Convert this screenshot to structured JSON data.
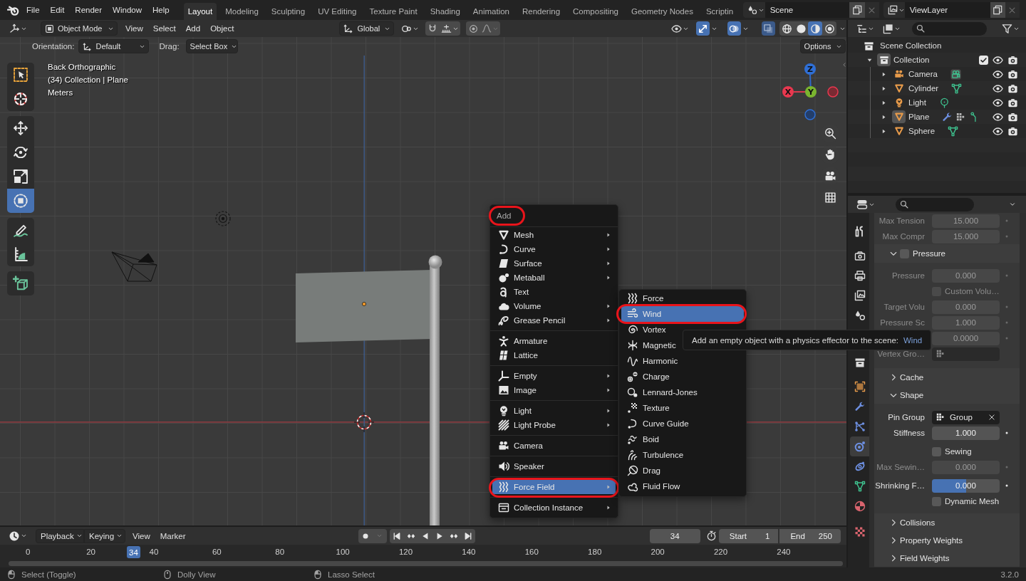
{
  "top_bar": {
    "menus": [
      "File",
      "Edit",
      "Render",
      "Window",
      "Help"
    ],
    "workspaces": [
      {
        "label": "Layout",
        "selected": true
      },
      {
        "label": "Modeling",
        "selected": false
      },
      {
        "label": "Sculpting",
        "selected": false
      },
      {
        "label": "UV Editing",
        "selected": false
      },
      {
        "label": "Texture Paint",
        "selected": false
      },
      {
        "label": "Shading",
        "selected": false
      },
      {
        "label": "Animation",
        "selected": false
      },
      {
        "label": "Rendering",
        "selected": false
      },
      {
        "label": "Compositing",
        "selected": false
      },
      {
        "label": "Geometry Nodes",
        "selected": false
      },
      {
        "label": "Scriptin",
        "selected": false
      }
    ],
    "scene": "Scene",
    "view_layer": "ViewLayer"
  },
  "viewport": {
    "header": {
      "mode": "Object Mode",
      "menus": [
        "View",
        "Select",
        "Add",
        "Object"
      ],
      "orientation": "Global",
      "gizmos_on": true,
      "overlays_on": true,
      "xray_on": true,
      "shading": [
        {
          "selected": false
        },
        {
          "selected": false
        },
        {
          "selected": true
        },
        {
          "selected": false
        }
      ]
    },
    "tool_settings": {
      "orientation_label": "Orientation:",
      "orientation": "Default",
      "drag_label": "Drag:",
      "drag": "Select Box",
      "options": "Options"
    },
    "tool_groups": [
      [
        {
          "selected": false
        },
        {
          "selected": false
        }
      ],
      [
        {
          "selected": false
        },
        {
          "selected": false
        },
        {
          "selected": false
        },
        {
          "selected": true
        }
      ],
      [
        {
          "selected": false
        },
        {
          "selected": false
        }
      ],
      [
        {
          "selected": false
        }
      ]
    ],
    "overlay_text": [
      "Back Orthographic",
      "(34) Collection | Plane",
      "Meters"
    ],
    "gizmo_labels": [
      "Z",
      "X",
      "Y"
    ]
  },
  "add_menu": {
    "title": "Add",
    "circled": true,
    "groups": [
      [
        {
          "label": "Mesh",
          "submenu": true,
          "selected": false,
          "circled": false
        },
        {
          "label": "Curve",
          "submenu": true,
          "selected": false,
          "circled": false
        },
        {
          "label": "Surface",
          "submenu": true,
          "selected": false,
          "circled": false
        },
        {
          "label": "Metaball",
          "submenu": true,
          "selected": false,
          "circled": false
        },
        {
          "label": "Text",
          "submenu": false,
          "selected": false,
          "circled": false
        },
        {
          "label": "Volume",
          "submenu": true,
          "selected": false,
          "circled": false
        },
        {
          "label": "Grease Pencil",
          "submenu": true,
          "selected": false,
          "circled": false
        }
      ],
      [
        {
          "label": "Armature",
          "submenu": false,
          "selected": false,
          "circled": false
        },
        {
          "label": "Lattice",
          "submenu": false,
          "selected": false,
          "circled": false
        }
      ],
      [
        {
          "label": "Empty",
          "submenu": true,
          "selected": false,
          "circled": false
        },
        {
          "label": "Image",
          "submenu": true,
          "selected": false,
          "circled": false
        }
      ],
      [
        {
          "label": "Light",
          "submenu": true,
          "selected": false,
          "circled": false
        },
        {
          "label": "Light Probe",
          "submenu": true,
          "selected": false,
          "circled": false
        }
      ],
      [
        {
          "label": "Camera",
          "submenu": false,
          "selected": false,
          "circled": false
        }
      ],
      [
        {
          "label": "Speaker",
          "submenu": false,
          "selected": false,
          "circled": false
        }
      ],
      [
        {
          "label": "Force Field",
          "submenu": true,
          "selected": true,
          "circled": true
        }
      ],
      [
        {
          "label": "Collection Instance",
          "submenu": true,
          "selected": false,
          "circled": false
        }
      ]
    ]
  },
  "force_field_menu": {
    "items": [
      {
        "label": "Force",
        "selected": false,
        "circled": false
      },
      {
        "label": "Wind",
        "selected": true,
        "circled": true
      },
      {
        "label": "Vortex",
        "selected": false,
        "circled": false
      },
      {
        "label": "Magnetic",
        "selected": false,
        "circled": false
      },
      {
        "label": "Harmonic",
        "selected": false,
        "circled": false
      },
      {
        "label": "Charge",
        "selected": false,
        "circled": false
      },
      {
        "label": "Lennard-Jones",
        "selected": false,
        "circled": false
      },
      {
        "label": "Texture",
        "selected": false,
        "circled": false
      },
      {
        "label": "Curve Guide",
        "selected": false,
        "circled": false
      },
      {
        "label": "Boid",
        "selected": false,
        "circled": false
      },
      {
        "label": "Turbulence",
        "selected": false,
        "circled": false
      },
      {
        "label": "Drag",
        "selected": false,
        "circled": false
      },
      {
        "label": "Fluid Flow",
        "selected": false,
        "circled": false
      }
    ]
  },
  "tooltip": {
    "text": "Add an empty object with a physics effector to the scene:",
    "operator": "Wind"
  },
  "outliner": {
    "root": "Scene Collection",
    "collection": {
      "label": "Collection",
      "expanded": true,
      "active": true,
      "checked": true,
      "children": [
        {
          "label": "Camera",
          "expanded": false,
          "active": false
        },
        {
          "label": "Cylinder",
          "expanded": false,
          "active": false
        },
        {
          "label": "Light",
          "expanded": false,
          "active": false
        },
        {
          "label": "Plane",
          "expanded": false,
          "active": true
        },
        {
          "label": "Sphere",
          "expanded": false,
          "active": false
        }
      ]
    }
  },
  "properties": {
    "tab_groups": [
      [
        {
          "selected": false
        }
      ],
      [
        {
          "selected": false
        },
        {
          "selected": false
        },
        {
          "selected": false
        },
        {
          "selected": false
        }
      ],
      [
        {
          "selected": false
        }
      ],
      [
        {
          "selected": false
        },
        {
          "selected": false
        },
        {
          "selected": false
        },
        {
          "selected": true
        },
        {
          "selected": false
        },
        {
          "selected": false
        },
        {
          "selected": false
        }
      ],
      [
        {
          "selected": false
        }
      ]
    ],
    "rows": [
      {
        "kind": "number",
        "label": "Max Tension",
        "value": "15.000",
        "disabled": true
      },
      {
        "kind": "number",
        "label": "Max Compr",
        "value": "15.000",
        "disabled": true
      }
    ],
    "subpanels": [
      {
        "title": "Pressure",
        "expanded": true,
        "checked": false,
        "blocks": [
          [
            {
              "kind": "number",
              "label": "Pressure",
              "value": "0.000",
              "disabled": true
            },
            {
              "kind": "checkbox",
              "label": "Custom Volu…",
              "checked": false,
              "disabled": true
            },
            {
              "kind": "number",
              "label": "Target Volu",
              "value": "0.000",
              "disabled": true
            },
            {
              "kind": "number",
              "label": "Pressure Sc",
              "value": "1.000",
              "disabled": true
            },
            {
              "kind": "number",
              "value": "0.0000",
              "disabled": true
            },
            {
              "kind": "group",
              "label": "Vertex Gro…",
              "disabled": true
            }
          ]
        ]
      },
      {
        "title": "Cache",
        "expanded": false
      },
      {
        "title": "Shape",
        "expanded": true,
        "blocks": [
          [
            {
              "kind": "group",
              "label": "Pin Group",
              "value": "Group",
              "disabled": false
            },
            {
              "kind": "number",
              "label": "Stiffness",
              "value": "1.000",
              "disabled": false
            }
          ],
          [
            {
              "kind": "checkbox",
              "label": "Sewing",
              "checked": false,
              "disabled": false
            },
            {
              "kind": "number",
              "label": "Max Sewin…",
              "value": "0.000",
              "disabled": true
            }
          ],
          [
            {
              "kind": "slider",
              "label": "Shrinking F…",
              "value": "0.000",
              "level": 0.5,
              "disabled": false
            },
            {
              "kind": "checkbox",
              "label": "Dynamic Mesh",
              "checked": false,
              "disabled": false
            }
          ]
        ]
      },
      {
        "title": "Collisions",
        "expanded": false
      },
      {
        "title": "Property Weights",
        "expanded": false
      },
      {
        "title": "Field Weights",
        "expanded": false
      }
    ]
  },
  "timeline": {
    "dropdowns": [
      "Playback",
      "Keying"
    ],
    "menus": [
      "View",
      "Marker"
    ],
    "frame": "34",
    "start_label": "Start",
    "start": "1",
    "end_label": "End",
    "end": "250",
    "ruler": [
      "0",
      "20",
      "40",
      "60",
      "80",
      "100",
      "120",
      "140",
      "160",
      "180",
      "200",
      "220",
      "240"
    ],
    "current_frame": "34"
  },
  "status_bar": {
    "hints": [
      "Select (Toggle)",
      "Dolly View",
      "Lasso Select"
    ],
    "version": "3.2.0"
  }
}
